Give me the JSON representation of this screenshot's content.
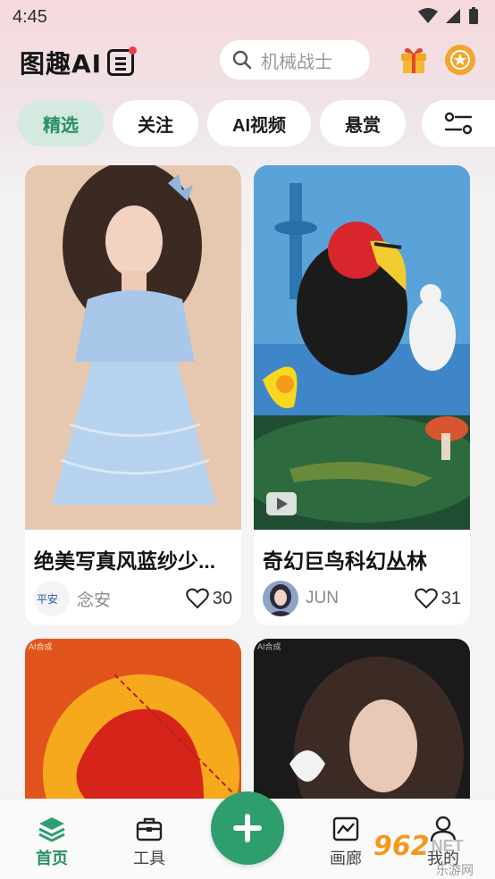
{
  "status_bar": {
    "time": "4:45"
  },
  "header": {
    "logo_text": "图趣AI",
    "search_placeholder": "机械战士"
  },
  "tabs": [
    {
      "label": "精选",
      "active": true
    },
    {
      "label": "关注",
      "active": false
    },
    {
      "label": "AI视频",
      "active": false
    },
    {
      "label": "悬赏",
      "active": false
    }
  ],
  "cards": [
    {
      "title": "绝美写真风蓝纱少...",
      "author": "念安",
      "likes": "30"
    },
    {
      "title": "奇幻巨鸟科幻丛林",
      "author": "JUN",
      "likes": "31"
    },
    {
      "badge": "AI合成"
    },
    {
      "badge": "AI合成"
    }
  ],
  "bottom_nav": {
    "home": "首页",
    "tools": "工具",
    "gallery": "画廊",
    "profile": "我的"
  },
  "watermark": {
    "num": "962",
    "net": "NET",
    "sub": "乐游网"
  },
  "colors": {
    "accent": "#2f9e6e",
    "tab_active_bg": "#d4e9e0"
  }
}
